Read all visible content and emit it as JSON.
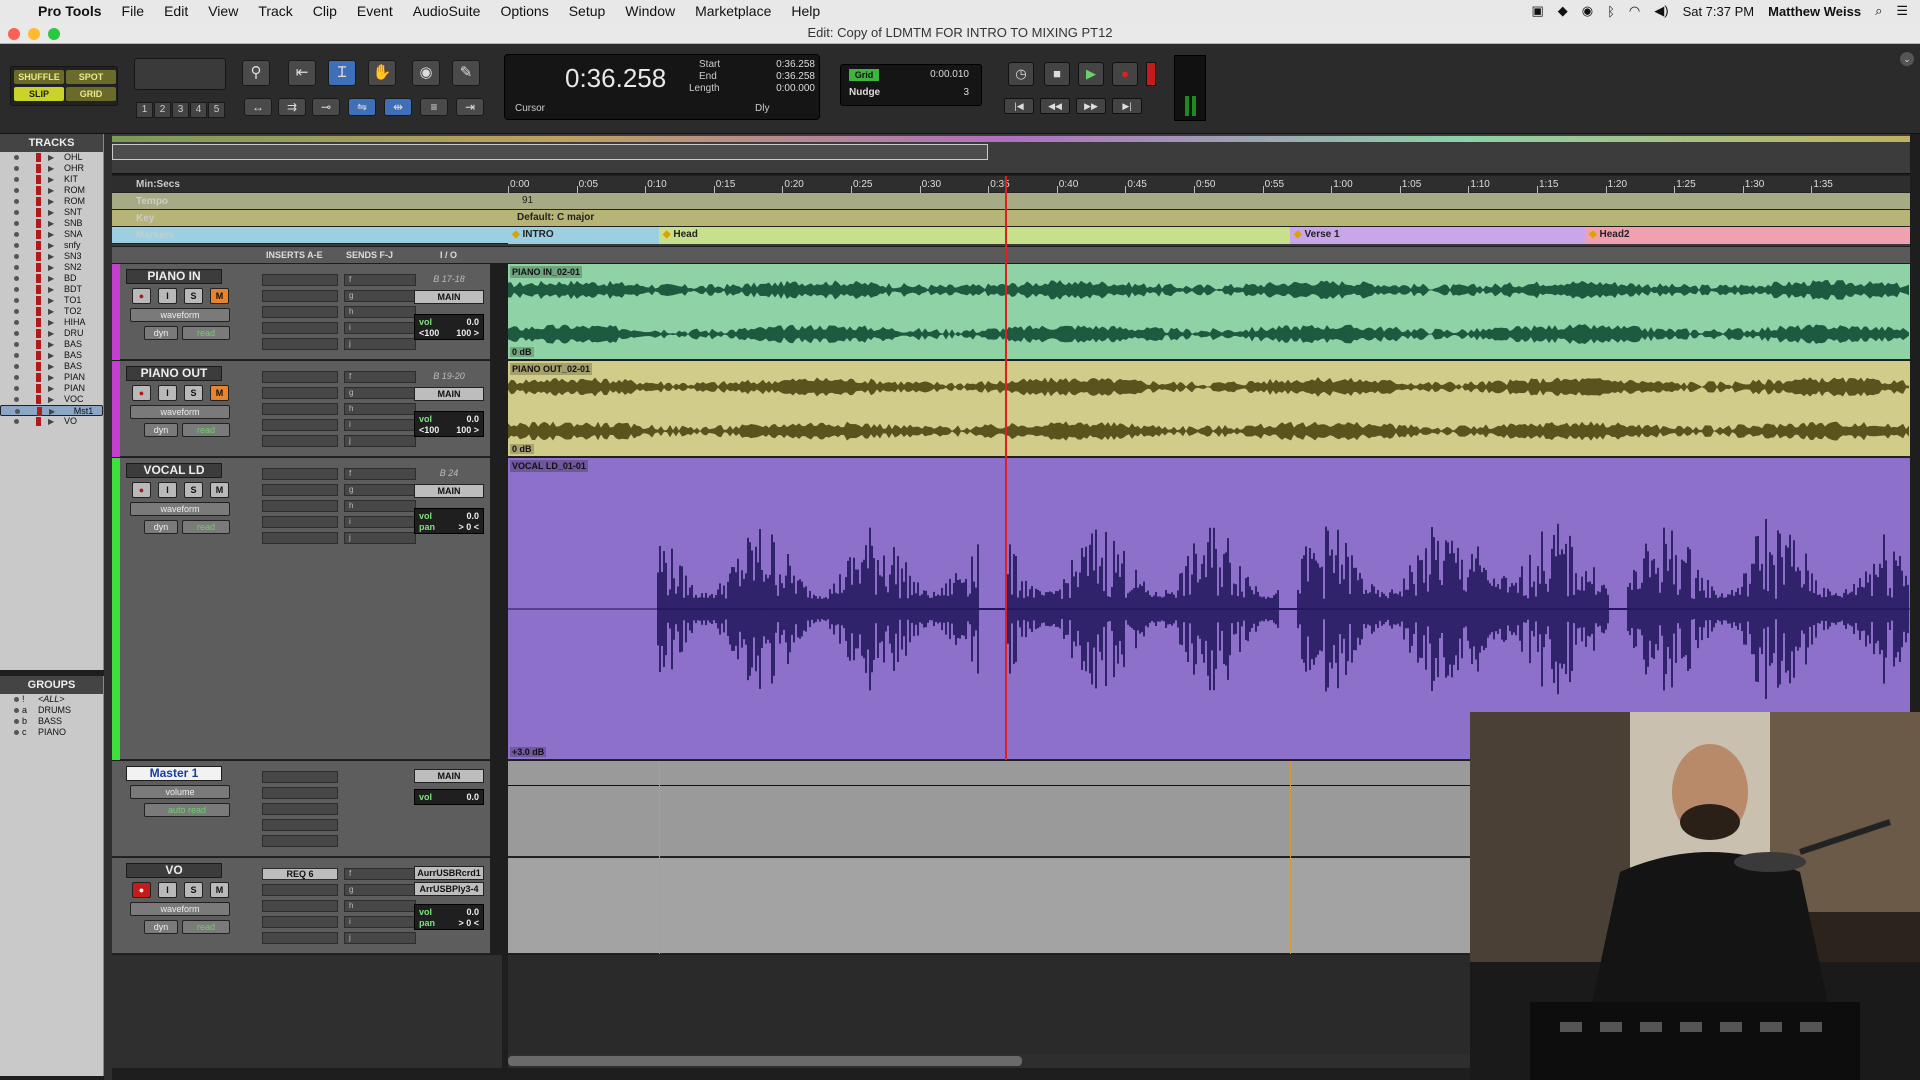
{
  "menubar": {
    "app": "Pro Tools",
    "items": [
      "File",
      "Edit",
      "View",
      "Track",
      "Clip",
      "Event",
      "AudioSuite",
      "Options",
      "Setup",
      "Window",
      "Marketplace",
      "Help"
    ],
    "clock": "Sat 7:37 PM",
    "user": "Matthew Weiss"
  },
  "window": {
    "title": "Edit: Copy of LDMTM FOR INTRO TO MIXING PT12"
  },
  "toolbar": {
    "modes": {
      "shuffle": "SHUFFLE",
      "spot": "SPOT",
      "slip": "SLIP",
      "grid": "GRID"
    },
    "zoom_presets": [
      "1",
      "2",
      "3",
      "4",
      "5"
    ],
    "counter": {
      "main": "0:36.258",
      "start_label": "Start",
      "start": "0:36.258",
      "end_label": "End",
      "end": "0:36.258",
      "length_label": "Length",
      "length": "0:00.000",
      "cursor_label": "Cursor",
      "dly": "Dly"
    },
    "grid": {
      "label": "Grid",
      "value": "0:00.010",
      "nudge_label": "Nudge",
      "nudge_value": "3"
    }
  },
  "tracks_panel": {
    "title": "TRACKS",
    "items": [
      "OHL",
      "OHR",
      "KIT",
      "ROM",
      "ROM",
      "SNT",
      "SNB",
      "SNA",
      "snfy",
      "SN3",
      "SN2",
      "BD",
      "BDT",
      "TO1",
      "TO2",
      "HIHA",
      "DRU",
      "BAS",
      "BAS",
      "BAS",
      "PIAN",
      "PIAN",
      "VOC",
      "Mst1",
      "VO"
    ]
  },
  "groups_panel": {
    "title": "GROUPS",
    "items": [
      {
        "id": "!",
        "name": "<ALL>"
      },
      {
        "id": "a",
        "name": "DRUMS"
      },
      {
        "id": "b",
        "name": "BASS"
      },
      {
        "id": "c",
        "name": "PIANO"
      }
    ]
  },
  "rulers": {
    "timebase": "Min:Secs",
    "tempo": "Tempo",
    "key": "Key",
    "markers_label": "Markers",
    "meter_value": "91",
    "key_value": "Default: C major",
    "ticks": [
      "0:00",
      "0:05",
      "0:10",
      "0:15",
      "0:20",
      "0:25",
      "0:30",
      "0:35",
      "0:40",
      "0:45",
      "0:50",
      "0:55",
      "1:00",
      "1:05",
      "1:10",
      "1:15",
      "1:20",
      "1:25",
      "1:30",
      "1:35"
    ],
    "markers": [
      {
        "name": "INTRO",
        "t": 0
      },
      {
        "name": "Head",
        "t": 11
      },
      {
        "name": "Verse 1",
        "t": 57
      },
      {
        "name": "Head2",
        "t": 78.5
      }
    ]
  },
  "columns": {
    "inserts": "INSERTS A-E",
    "sends": "SENDS F-J",
    "io": "I / O"
  },
  "tracks": [
    {
      "name": "PIANO IN",
      "view": "waveform",
      "dyn": "dyn",
      "auto": "read",
      "io_top": "B 17-18",
      "io_out": "MAIN",
      "vol_label": "vol",
      "vol": "0.0",
      "pan_l": "<100",
      "pan_r": "100 >",
      "clip": "PIANO IN_02-01",
      "gain": "0 dB",
      "color": "#c23fd0",
      "lane_color": "#8fd2a6",
      "wave_color": "#1d5a40"
    },
    {
      "name": "PIANO OUT",
      "view": "waveform",
      "dyn": "dyn",
      "auto": "read",
      "io_top": "B 19-20",
      "io_out": "MAIN",
      "vol_label": "vol",
      "vol": "0.0",
      "pan_l": "<100",
      "pan_r": "100 >",
      "clip": "PIANO OUT_02-01",
      "gain": "0 dB",
      "color": "#c23fd0",
      "lane_color": "#d2cc8a",
      "wave_color": "#5a531d"
    },
    {
      "name": "VOCAL LD",
      "view": "waveform",
      "dyn": "dyn",
      "auto": "read",
      "io_top": "B 24",
      "io_out": "MAIN",
      "vol_label": "vol",
      "vol": "0.0",
      "pan_label": "pan",
      "pan": "> 0 <",
      "clip": "VOCAL LD_01-01",
      "gain": "+3.0 dB",
      "color": "#3ee03e",
      "lane_color": "#8d70c9",
      "wave_color": "#1a0f54"
    },
    {
      "name": "Master 1",
      "view": "volume",
      "auto": "auto read",
      "io_out": "MAIN",
      "vol_label": "vol",
      "vol": "0.0"
    },
    {
      "name": "VO",
      "view": "waveform",
      "dyn": "dyn",
      "auto": "read",
      "insert": "REQ 6",
      "io_in": "AurrUSBRcrd1",
      "io_out": "ArrUSBPly3-4",
      "vol_label": "vol",
      "vol": "0.0",
      "pan_label": "pan",
      "pan": "> 0 <"
    }
  ],
  "send_letters": [
    "f",
    "g",
    "h",
    "i",
    "j"
  ],
  "buttons": {
    "rec": "●",
    "input": "I",
    "solo": "S",
    "mute": "M"
  },
  "colors": {
    "accent_blue": "#3f6fb6",
    "playhead": "#e02020",
    "marker_bar": "#f0a0b0"
  }
}
